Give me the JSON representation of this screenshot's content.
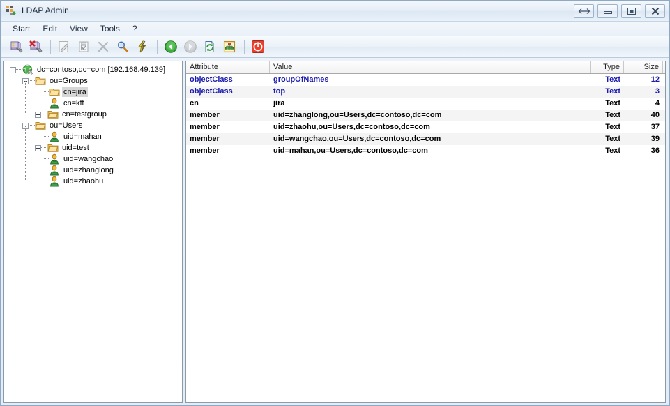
{
  "window": {
    "title": "LDAP Admin",
    "app_icon": "ldap-network-plug-icon",
    "buttons": [
      {
        "name": "resize-button",
        "icon": "double-arrow-icon",
        "label": ""
      },
      {
        "name": "minimize-button",
        "icon": "minimize-icon",
        "label": ""
      },
      {
        "name": "maximize-button",
        "icon": "maximize-icon",
        "label": ""
      },
      {
        "name": "close-button",
        "icon": "close-icon",
        "label": ""
      }
    ]
  },
  "menubar": {
    "items": [
      {
        "label": "Start"
      },
      {
        "label": "Edit"
      },
      {
        "label": "View"
      },
      {
        "label": "Tools"
      },
      {
        "label": "?"
      }
    ]
  },
  "toolbar": {
    "items": [
      {
        "name": "connect-button",
        "icon": "server-connect-icon",
        "disabled": false
      },
      {
        "name": "disconnect-button",
        "icon": "server-disconnect-icon",
        "disabled": false
      },
      {
        "name": "separator-1",
        "icon": "separator",
        "disabled": false
      },
      {
        "name": "edit-entry-button",
        "icon": "edit-pencil-icon",
        "disabled": true
      },
      {
        "name": "save-entry-button",
        "icon": "save-check-icon",
        "disabled": true
      },
      {
        "name": "delete-entry-button",
        "icon": "delete-x-icon",
        "disabled": true
      },
      {
        "name": "search-button",
        "icon": "magnifier-icon",
        "disabled": false
      },
      {
        "name": "quick-action-button",
        "icon": "lightning-bolt-icon",
        "disabled": false
      },
      {
        "name": "separator-2",
        "icon": "separator",
        "disabled": false
      },
      {
        "name": "back-button",
        "icon": "back-arrow-icon",
        "disabled": false
      },
      {
        "name": "forward-button",
        "icon": "forward-arrow-icon",
        "disabled": true
      },
      {
        "name": "refresh-button",
        "icon": "refresh-page-icon",
        "disabled": false
      },
      {
        "name": "organization-button",
        "icon": "org-tree-icon",
        "disabled": false
      },
      {
        "name": "separator-3",
        "icon": "separator",
        "disabled": false
      },
      {
        "name": "exit-button",
        "icon": "power-exit-icon",
        "disabled": false
      }
    ]
  },
  "tree": {
    "nodes": [
      {
        "label": "dc=contoso,dc=com [192.168.49.139]",
        "icon": "globe-icon",
        "depth": 0,
        "expander": "minus",
        "selected": false
      },
      {
        "label": "ou=Groups",
        "icon": "folder-icon",
        "depth": 1,
        "expander": "minus",
        "selected": false
      },
      {
        "label": "cn=jira",
        "icon": "folder-icon",
        "depth": 2,
        "expander": "none",
        "selected": true
      },
      {
        "label": "cn=kff",
        "icon": "user-icon",
        "depth": 2,
        "expander": "none",
        "selected": false
      },
      {
        "label": "cn=testgroup",
        "icon": "folder-icon",
        "depth": 2,
        "expander": "plus",
        "selected": false
      },
      {
        "label": "ou=Users",
        "icon": "folder-icon",
        "depth": 1,
        "expander": "minus",
        "selected": false
      },
      {
        "label": "uid=mahan",
        "icon": "user-icon",
        "depth": 2,
        "expander": "none",
        "selected": false
      },
      {
        "label": "uid=test",
        "icon": "folder-icon",
        "depth": 2,
        "expander": "plus",
        "selected": false
      },
      {
        "label": "uid=wangchao",
        "icon": "user-icon",
        "depth": 2,
        "expander": "none",
        "selected": false
      },
      {
        "label": "uid=zhanglong",
        "icon": "user-icon",
        "depth": 2,
        "expander": "none",
        "selected": false
      },
      {
        "label": "uid=zhaohu",
        "icon": "user-icon",
        "depth": 2,
        "expander": "none",
        "selected": false
      }
    ]
  },
  "list": {
    "columns": [
      {
        "label": "Attribute",
        "align": "left"
      },
      {
        "label": "Value",
        "align": "left"
      },
      {
        "label": "Type",
        "align": "right"
      },
      {
        "label": "Size",
        "align": "right"
      }
    ],
    "rows": [
      {
        "attribute": "objectClass",
        "value": "groupOfNames",
        "type": "Text",
        "size": "12",
        "highlight": true
      },
      {
        "attribute": "objectClass",
        "value": "top",
        "type": "Text",
        "size": "3",
        "highlight": true
      },
      {
        "attribute": "cn",
        "value": "jira",
        "type": "Text",
        "size": "4",
        "highlight": false
      },
      {
        "attribute": "member",
        "value": "uid=zhanglong,ou=Users,dc=contoso,dc=com",
        "type": "Text",
        "size": "40",
        "highlight": false
      },
      {
        "attribute": "member",
        "value": "uid=zhaohu,ou=Users,dc=contoso,dc=com",
        "type": "Text",
        "size": "37",
        "highlight": false
      },
      {
        "attribute": "member",
        "value": "uid=wangchao,ou=Users,dc=contoso,dc=com",
        "type": "Text",
        "size": "39",
        "highlight": false
      },
      {
        "attribute": "member",
        "value": "uid=mahan,ou=Users,dc=contoso,dc=com",
        "type": "Text",
        "size": "36",
        "highlight": false
      }
    ]
  },
  "colors": {
    "highlight_text": "#1a1ab0",
    "normal_text": "#000000",
    "selection": "#d6d6d6",
    "alt_row": "#f4f4f4",
    "panel_border": "#8a9aab"
  }
}
